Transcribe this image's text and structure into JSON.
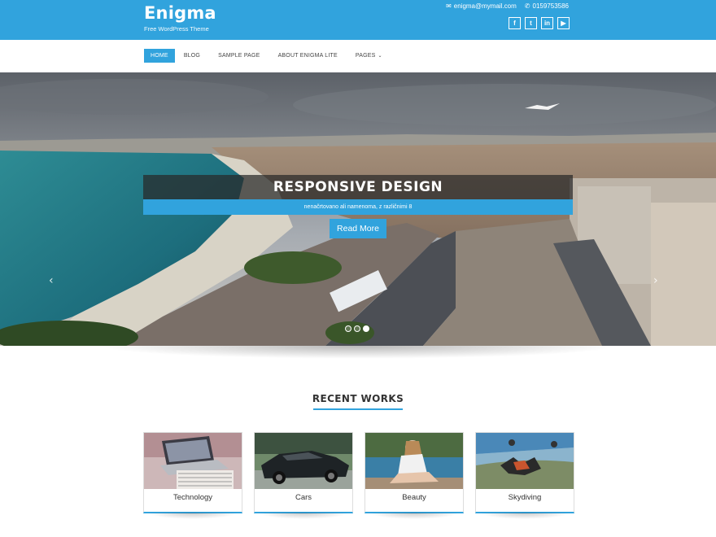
{
  "header": {
    "site_title": "Enigma",
    "tagline": "Free WordPress Theme",
    "email": "enigma@mymail.com",
    "phone": "0159753586",
    "email_icon": "envelope-icon",
    "phone_icon": "phone-icon",
    "social": [
      {
        "icon": "facebook-icon",
        "glyph": "f"
      },
      {
        "icon": "twitter-icon",
        "glyph": "t"
      },
      {
        "icon": "linkedin-icon",
        "glyph": "in"
      },
      {
        "icon": "youtube-icon",
        "glyph": "▶"
      }
    ],
    "color": "#31a3dd"
  },
  "nav": {
    "items": [
      {
        "label": "HOME",
        "active": true
      },
      {
        "label": "BLOG"
      },
      {
        "label": "SAMPLE PAGE"
      },
      {
        "label": "ABOUT ENIGMA LITE"
      },
      {
        "label": "PAGES",
        "dropdown": true
      }
    ]
  },
  "slider": {
    "title": "RESPONSIVE DESIGN",
    "subtitle": "nenačrtovano ali namenoma, z različnimi 8",
    "button": "Read More",
    "prev": "‹",
    "next": "›",
    "slide_count": 3,
    "active_slide": 3
  },
  "recent_works": {
    "heading": "RECENT WORKS",
    "items": [
      {
        "label": "Technology"
      },
      {
        "label": "Cars"
      },
      {
        "label": "Beauty"
      },
      {
        "label": "Skydiving"
      }
    ]
  }
}
